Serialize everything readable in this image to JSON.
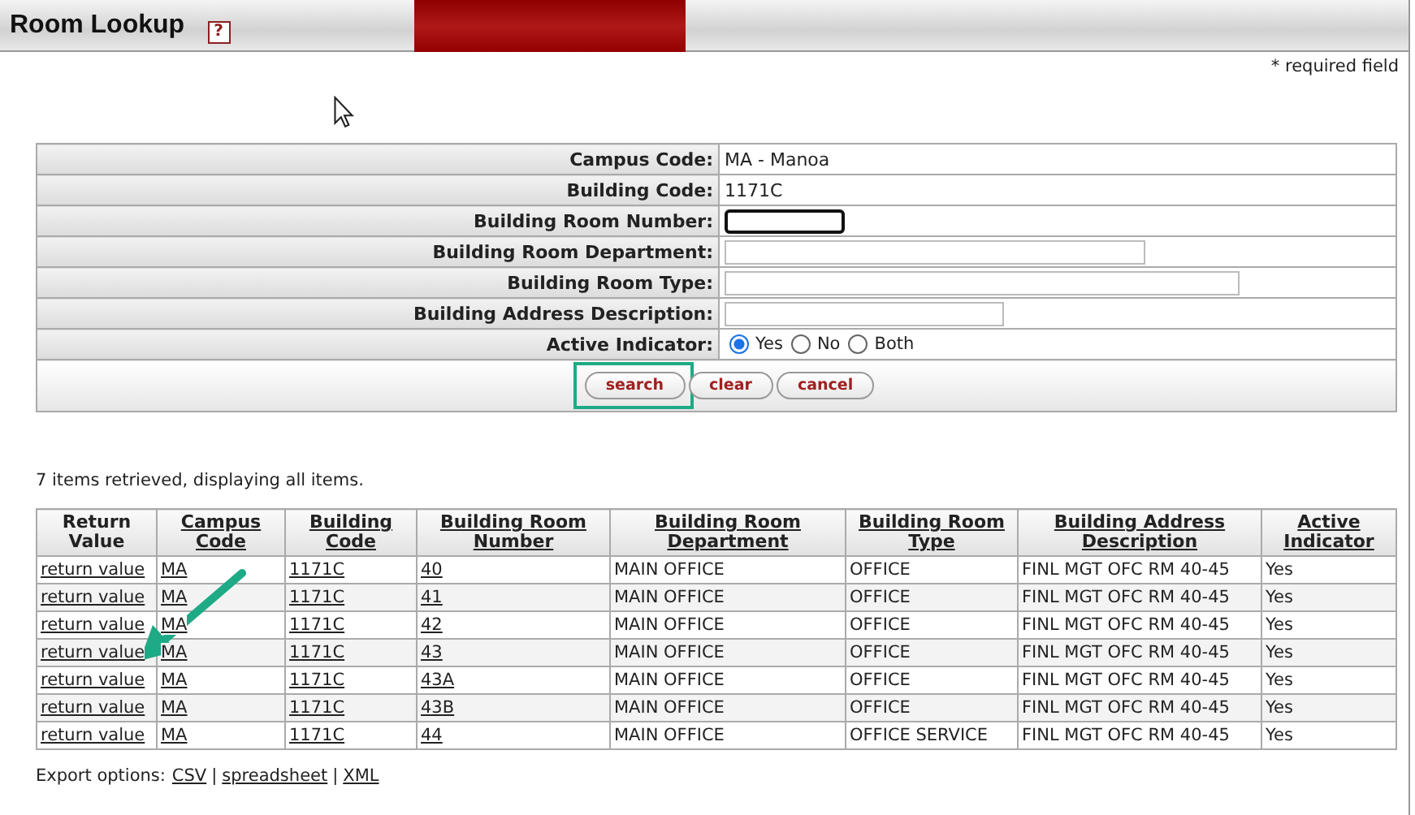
{
  "header": {
    "title": "Room Lookup",
    "help": "?"
  },
  "required_note": "* required field",
  "criteria": [
    {
      "kind": "text",
      "label": "Campus Code:",
      "value": "MA - Manoa"
    },
    {
      "kind": "text",
      "label": "Building Code:",
      "value": "1171C"
    },
    {
      "kind": "input",
      "label": "Building Room Number:",
      "focused": true
    },
    {
      "kind": "input",
      "label": "Building Room Department:",
      "focused": false
    },
    {
      "kind": "input",
      "label": "Building Room Type:",
      "focused": false
    },
    {
      "kind": "input",
      "label": "Building Address Description:",
      "focused": false
    },
    {
      "kind": "radio",
      "label": "Active Indicator:",
      "options": [
        {
          "label": "Yes",
          "selected": true
        },
        {
          "label": "No",
          "selected": false
        },
        {
          "label": "Both",
          "selected": false
        }
      ]
    }
  ],
  "buttons": [
    {
      "label": "search",
      "highlighted": true
    },
    {
      "label": "clear",
      "highlighted": false
    },
    {
      "label": "cancel",
      "highlighted": false
    }
  ],
  "results": {
    "summary": "7 items retrieved, displaying all items.",
    "columns": [
      {
        "label": "Return Value",
        "sortable": false,
        "link": true
      },
      {
        "label": "Campus Code",
        "sortable": true,
        "link": true
      },
      {
        "label": "Building Code",
        "sortable": true,
        "link": true
      },
      {
        "label": "Building Room Number",
        "sortable": true,
        "link": true
      },
      {
        "label": "Building Room Department",
        "sortable": true,
        "link": false
      },
      {
        "label": "Building Room Type",
        "sortable": true,
        "link": false
      },
      {
        "label": "Building Address Description",
        "sortable": true,
        "link": false
      },
      {
        "label": "Active Indicator",
        "sortable": true,
        "link": false
      }
    ],
    "rows": [
      [
        "return value",
        "MA",
        "1171C",
        "40",
        "MAIN OFFICE",
        "OFFICE",
        "FINL MGT OFC RM 40-45",
        "Yes"
      ],
      [
        "return value",
        "MA",
        "1171C",
        "41",
        "MAIN OFFICE",
        "OFFICE",
        "FINL MGT OFC RM 40-45",
        "Yes"
      ],
      [
        "return value",
        "MA",
        "1171C",
        "42",
        "MAIN OFFICE",
        "OFFICE",
        "FINL MGT OFC RM 40-45",
        "Yes"
      ],
      [
        "return value",
        "MA",
        "1171C",
        "43",
        "MAIN OFFICE",
        "OFFICE",
        "FINL MGT OFC RM 40-45",
        "Yes"
      ],
      [
        "return value",
        "MA",
        "1171C",
        "43A",
        "MAIN OFFICE",
        "OFFICE",
        "FINL MGT OFC RM 40-45",
        "Yes"
      ],
      [
        "return value",
        "MA",
        "1171C",
        "43B",
        "MAIN OFFICE",
        "OFFICE",
        "FINL MGT OFC RM 40-45",
        "Yes"
      ],
      [
        "return value",
        "MA",
        "1171C",
        "44",
        "MAIN OFFICE",
        "OFFICE SERVICE",
        "FINL MGT OFC RM 40-45",
        "Yes"
      ]
    ]
  },
  "export": [
    {
      "kind": "label",
      "text": "Export options:"
    },
    {
      "kind": "link",
      "text": "CSV"
    },
    {
      "kind": "separator",
      "text": "|"
    },
    {
      "kind": "link",
      "text": "spreadsheet"
    },
    {
      "kind": "separator",
      "text": "|"
    },
    {
      "kind": "link",
      "text": "XML"
    }
  ]
}
